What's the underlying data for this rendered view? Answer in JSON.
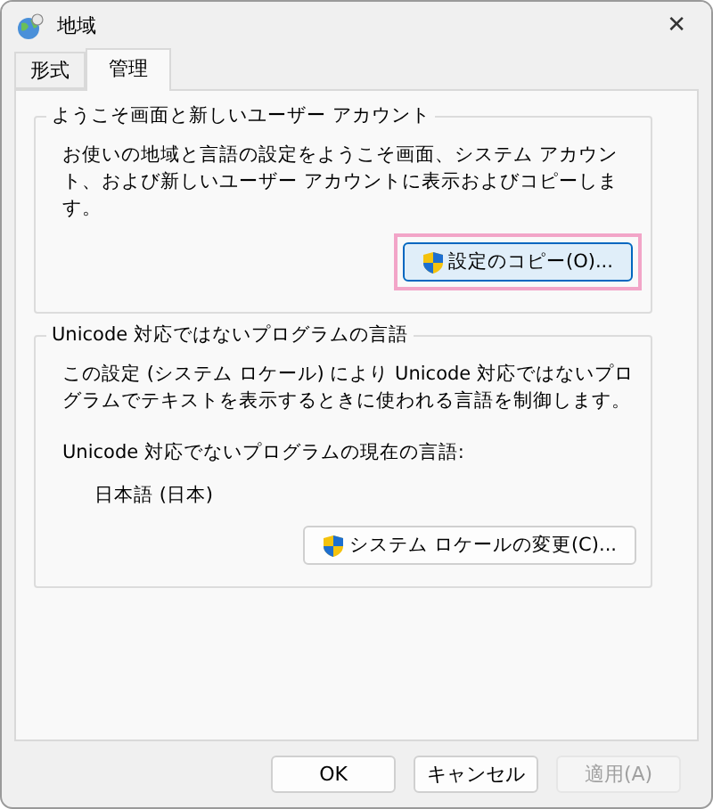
{
  "window": {
    "title": "地域",
    "close": "✕"
  },
  "tabs": [
    {
      "label": "形式",
      "selected": false
    },
    {
      "label": "管理",
      "selected": true
    }
  ],
  "groups": [
    {
      "title": "ようこそ画面と新しいユーザー アカウント",
      "description": "お使いの地域と言語の設定をようこそ画面、システム アカウント、および新しいユーザー アカウントに表示およびコピーします。",
      "button": {
        "label": "設定のコピー(O)...",
        "highlighted": true,
        "focused": true
      }
    },
    {
      "title": "Unicode 対応ではないプログラムの言語",
      "description": "この設定 (システム ロケール) により Unicode 対応ではないプログラムでテキストを表示するときに使われる言語を制御します。",
      "current_label": "Unicode 対応でないプログラムの現在の言語:",
      "current_value": "日本語 (日本)",
      "button": {
        "label": "システム ロケールの変更(C)...",
        "highlighted": false,
        "focused": false
      }
    }
  ],
  "buttons": [
    {
      "label": "OK",
      "disabled": false
    },
    {
      "label": "キャンセル",
      "disabled": false
    },
    {
      "label": "適用(A)",
      "disabled": true
    }
  ]
}
